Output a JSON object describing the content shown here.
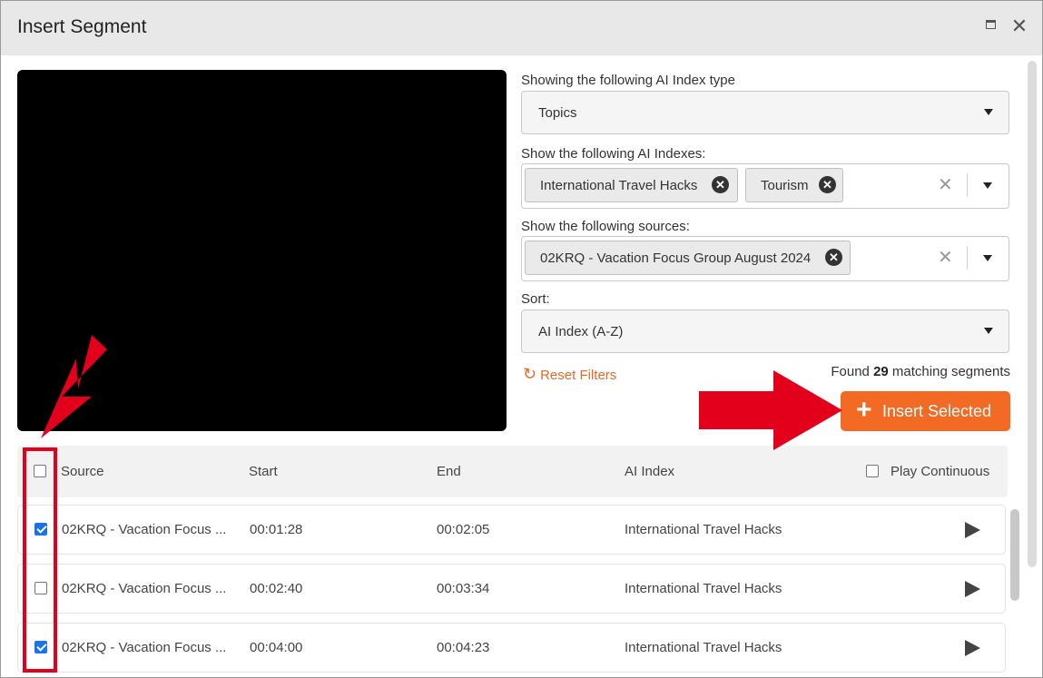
{
  "dialog": {
    "title": "Insert Segment"
  },
  "filters": {
    "index_type_label": "Showing the following AI Index type",
    "index_type_value": "Topics",
    "indexes_label": "Show the following AI Indexes:",
    "indexes_chips": [
      "International Travel Hacks",
      "Tourism"
    ],
    "sources_label": "Show the following sources:",
    "sources_chips": [
      "02KRQ - Vacation Focus Group August 2024"
    ],
    "sort_label": "Sort:",
    "sort_value": "AI Index (A-Z)",
    "reset_label": "Reset Filters",
    "found_prefix": "Found",
    "found_count": "29",
    "found_suffix": "matching segments",
    "insert_label": "Insert Selected"
  },
  "table": {
    "headers": [
      "Source",
      "Start",
      "End",
      "AI Index"
    ],
    "play_continuous_label": "Play Continuous",
    "rows": [
      {
        "source": "02KRQ - Vacation Focus ...",
        "start": "00:01:28",
        "end": "00:02:05",
        "ai_index": "International Travel Hacks",
        "checked": true
      },
      {
        "source": "02KRQ - Vacation Focus ...",
        "start": "00:02:40",
        "end": "00:03:34",
        "ai_index": "International Travel Hacks",
        "checked": false
      },
      {
        "source": "02KRQ - Vacation Focus ...",
        "start": "00:04:00",
        "end": "00:04:23",
        "ai_index": "International Travel Hacks",
        "checked": true
      }
    ]
  },
  "colors": {
    "accent": "#f26a24",
    "annotation": "#e2001a",
    "checkbox": "#1a73e8"
  }
}
